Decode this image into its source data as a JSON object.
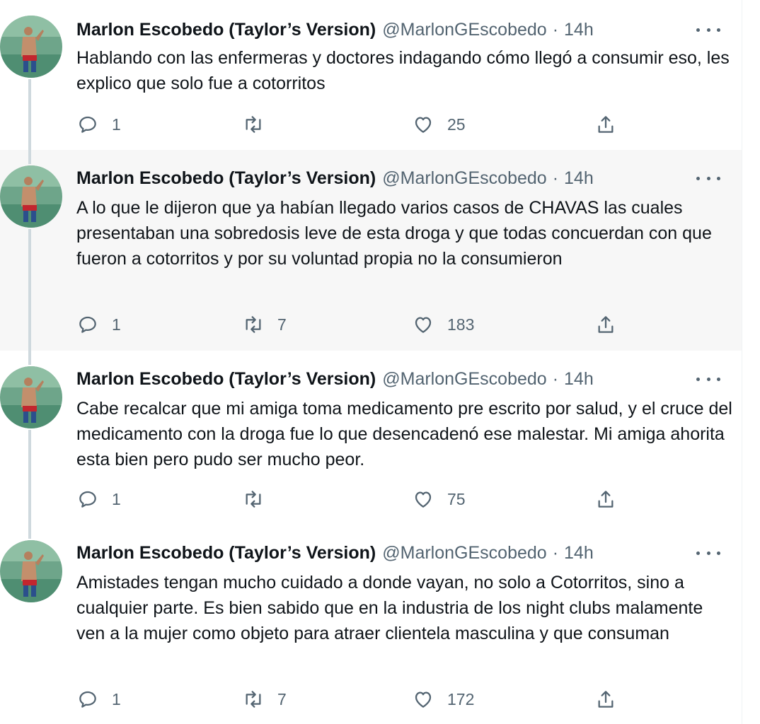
{
  "colors": {
    "text_primary": "#0f1419",
    "text_secondary": "#536471",
    "highlight_bg": "#f7f7f7",
    "thread_line": "#cfd9de"
  },
  "icons": [
    "reply-icon",
    "retweet-icon",
    "like-icon",
    "share-icon",
    "more-icon"
  ],
  "tweets": [
    {
      "name": "Marlon Escobedo (Taylor’s Version)",
      "handle": "@MarlonGEscobedo",
      "separator": "·",
      "time": "14h",
      "text": "Hablando con las enfermeras y doctores indagando cómo llegó a consumir eso, les explico que solo fue a cotorritos",
      "replies": "1",
      "retweets": "",
      "likes": "25"
    },
    {
      "name": "Marlon Escobedo (Taylor’s Version)",
      "handle": "@MarlonGEscobedo",
      "separator": "·",
      "time": "14h",
      "text": "A lo que le dijeron que ya habían llegado varios casos de CHAVAS las cuales presentaban una sobredosis leve de esta droga y que todas concuerdan con que fueron a cotorritos y por su voluntad propia no la consumieron",
      "replies": "1",
      "retweets": "7",
      "likes": "183"
    },
    {
      "name": "Marlon Escobedo (Taylor’s Version)",
      "handle": "@MarlonGEscobedo",
      "separator": "·",
      "time": "14h",
      "text": "Cabe recalcar que mi amiga toma medicamento pre escrito por salud, y el cruce del medicamento con la droga fue lo que desencadenó ese malestar. Mi amiga ahorita esta bien pero pudo ser mucho peor.",
      "replies": "1",
      "retweets": "",
      "likes": "75"
    },
    {
      "name": "Marlon Escobedo (Taylor’s Version)",
      "handle": "@MarlonGEscobedo",
      "separator": "·",
      "time": "14h",
      "text": "Amistades tengan mucho cuidado a donde vayan, no solo a Cotorritos, sino a cualquier parte. Es bien sabido que en la industria de los night clubs malamente ven a la mujer como objeto para atraer clientela masculina y que consuman",
      "replies": "1",
      "retweets": "7",
      "likes": "172"
    }
  ]
}
